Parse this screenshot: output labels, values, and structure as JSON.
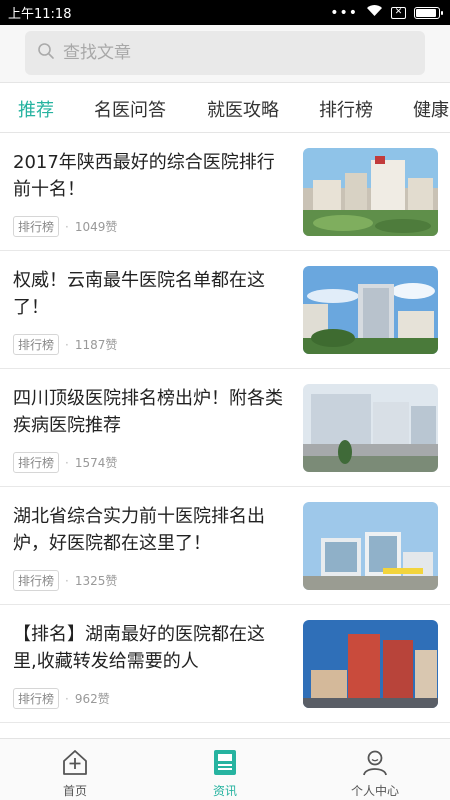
{
  "status_bar": {
    "time": "上午11:18",
    "dots": "•••",
    "sim": "✕",
    "battery_level": 0.9
  },
  "search": {
    "placeholder": "查找文章"
  },
  "tabs": [
    {
      "label": "推荐"
    },
    {
      "label": "名医问答"
    },
    {
      "label": "就医攻略"
    },
    {
      "label": "排行榜"
    },
    {
      "label": "健康"
    }
  ],
  "articles": [
    {
      "title": "2017年陕西最好的综合医院排行前十名！",
      "tag": "排行榜",
      "dot": "·",
      "likes": "1049赞"
    },
    {
      "title": "权威！云南最牛医院名单都在这了！",
      "tag": "排行榜",
      "dot": "·",
      "likes": "1187赞"
    },
    {
      "title": "四川顶级医院排名榜出炉！附各类疾病医院推荐",
      "tag": "排行榜",
      "dot": "·",
      "likes": "1574赞"
    },
    {
      "title": "湖北省综合实力前十医院排名出炉，好医院都在这里了！",
      "tag": "排行榜",
      "dot": "·",
      "likes": "1325赞"
    },
    {
      "title": "【排名】湖南最好的医院都在这里,收藏转发给需要的人",
      "tag": "排行榜",
      "dot": "·",
      "likes": "962赞"
    }
  ],
  "bottom_nav": [
    {
      "label": "首页",
      "icon": "home-plus-icon"
    },
    {
      "label": "资讯",
      "icon": "news-icon"
    },
    {
      "label": "个人中心",
      "icon": "person-icon"
    }
  ],
  "colors": {
    "accent": "#26b3a0"
  }
}
